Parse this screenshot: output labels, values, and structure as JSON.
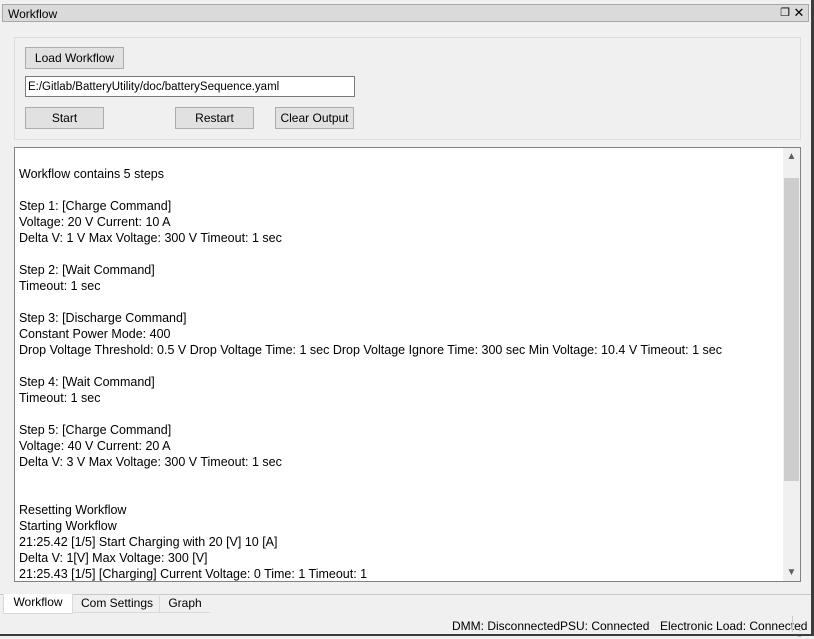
{
  "window": {
    "title": "Workflow",
    "float_icon": "float-restore-icon",
    "close_icon": "close-icon"
  },
  "controls": {
    "load_label": "Load Workflow",
    "path_value": "E:/Gitlab/BatteryUtility/doc/batterySequence.yaml",
    "start_label": "Start",
    "restart_label": "Restart",
    "clear_label": "Clear Output"
  },
  "output": {
    "lines": [
      "Workflow contains 5 steps",
      "",
      "Step 1: [Charge Command]",
      "Voltage: 20 V Current: 10 A",
      "Delta V: 1 V Max Voltage: 300 V Timeout: 1 sec",
      "",
      "Step 2: [Wait Command]",
      "Timeout: 1 sec",
      "",
      "Step 3: [Discharge Command]",
      "Constant Power Mode: 400",
      "Drop Voltage Threshold: 0.5 V Drop Voltage Time: 1 sec Drop Voltage Ignore Time: 300 sec Min Voltage: 10.4 V Timeout: 1 sec",
      "",
      "Step 4: [Wait Command]",
      "Timeout: 1 sec",
      "",
      "Step 5: [Charge Command]",
      "Voltage: 40 V Current: 20 A",
      "Delta V: 3 V Max Voltage: 300 V Timeout: 1 sec",
      "",
      "",
      "Resetting Workflow",
      "Starting Workflow",
      "21:25.42 [1/5] Start Charging with 20 [V] 10 [A]",
      "Delta V: 1[V] Max Voltage: 300 [V]",
      "21:25.43 [1/5] [Charging] Current Voltage: 0 Time: 1 Timeout: 1"
    ],
    "scroll_up_icon": "chevron-up-icon",
    "scroll_down_icon": "chevron-down-icon"
  },
  "tabs": [
    {
      "label": "Workflow",
      "active": true
    },
    {
      "label": "Com Settings",
      "active": false
    },
    {
      "label": "Graph",
      "active": false
    }
  ],
  "statusbar": {
    "dmm": "DMM: Disconnected",
    "psu": "PSU: Connected",
    "load": "Electronic Load: Connected"
  }
}
